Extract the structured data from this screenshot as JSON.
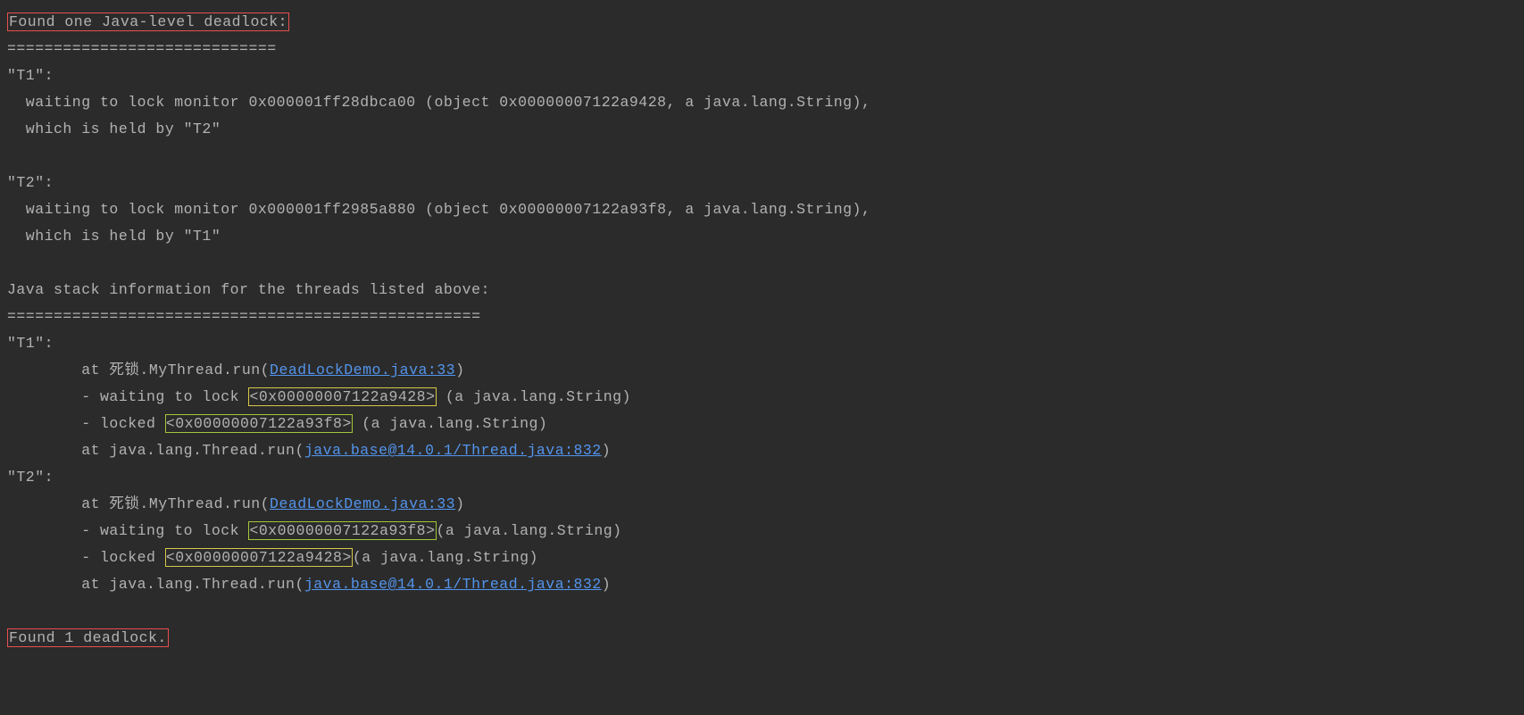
{
  "header": "Found one Java-level deadlock:",
  "div1": "=============================",
  "t1": {
    "label": "\"T1\":",
    "wait": "  waiting to lock monitor 0x000001ff28dbca00 (object 0x00000007122a9428, a java.lang.String),",
    "held": "  which is held by \"T2\""
  },
  "t2": {
    "label": "\"T2\":",
    "wait": "  waiting to lock monitor 0x000001ff2985a880 (object 0x00000007122a93f8, a java.lang.String),",
    "held": "  which is held by \"T1\""
  },
  "stackHeader": "Java stack information for the threads listed above:",
  "div2": "===================================================",
  "stack": {
    "t1": {
      "label": "\"T1\":",
      "at1_pre": "        at 死锁.MyThread.run(",
      "at1_link": "DeadLockDemo.java:33",
      "at1_post": ")",
      "wait_pre": "        - waiting to lock ",
      "wait_box": "<0x00000007122a9428>",
      "wait_post": " (a java.lang.String)",
      "lock_pre": "        - locked ",
      "lock_box": "<0x00000007122a93f8>",
      "lock_post": " (a java.lang.String)",
      "at2_pre": "        at java.lang.Thread.run(",
      "at2_link": "java.base@14.0.1/Thread.java:832",
      "at2_post": ")"
    },
    "t2": {
      "label": "\"T2\":",
      "at1_pre": "        at 死锁.MyThread.run(",
      "at1_link": "DeadLockDemo.java:33",
      "at1_post": ")",
      "wait_pre": "        - waiting to lock ",
      "wait_box": "<0x00000007122a93f8>",
      "wait_post": "(a java.lang.String)",
      "lock_pre": "        - locked ",
      "lock_box": "<0x00000007122a9428>",
      "lock_post": "(a java.lang.String)",
      "at2_pre": "        at java.lang.Thread.run(",
      "at2_link": "java.base@14.0.1/Thread.java:832",
      "at2_post": ")"
    }
  },
  "footer": "Found 1 deadlock."
}
